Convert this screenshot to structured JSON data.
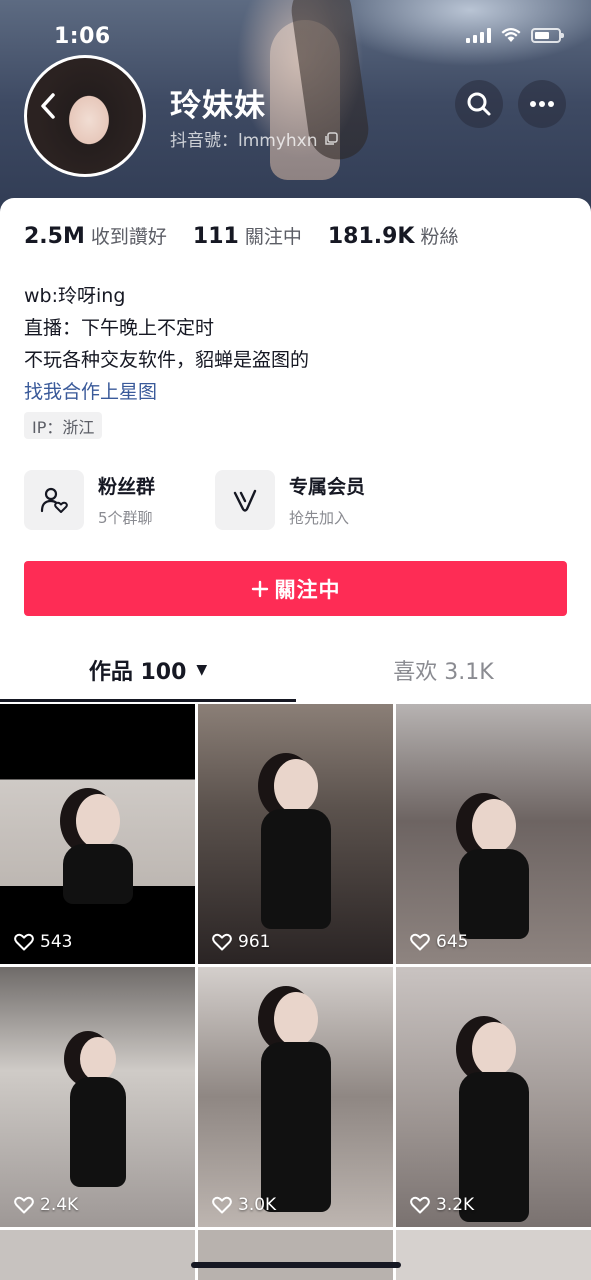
{
  "status_bar": {
    "time": "1:06"
  },
  "profile": {
    "nickname": "玲妹妹",
    "douyin_id": "抖音號：lmmyhxn"
  },
  "stats": [
    {
      "value": "2.5M",
      "label": "收到讚好"
    },
    {
      "value": "111",
      "label": "關注中"
    },
    {
      "value": "181.9K",
      "label": "粉絲"
    }
  ],
  "bio": {
    "line1": "wb:玲呀ing",
    "line2": "直播：下午晚上不定时",
    "line3": "不玩各种交友软件，貂蝉是盗图的",
    "link": "找我合作上星图"
  },
  "ip_tag": "IP：浙江",
  "features": [
    {
      "title": "粉丝群",
      "subtitle": "5个群聊",
      "icon": "group-chat-icon"
    },
    {
      "title": "专属会员",
      "subtitle": "抢先加入",
      "icon": "vip-icon"
    }
  ],
  "follow_button": {
    "label": "關注中",
    "icon": "plus-icon",
    "color": "#fe2c55"
  },
  "tabs": {
    "works": "作品 100",
    "likes": "喜欢 3.1K"
  },
  "videos": [
    {
      "likes": "543"
    },
    {
      "likes": "961"
    },
    {
      "likes": "645"
    },
    {
      "likes": "2.4K"
    },
    {
      "likes": "3.0K"
    },
    {
      "likes": "3.2K"
    }
  ]
}
